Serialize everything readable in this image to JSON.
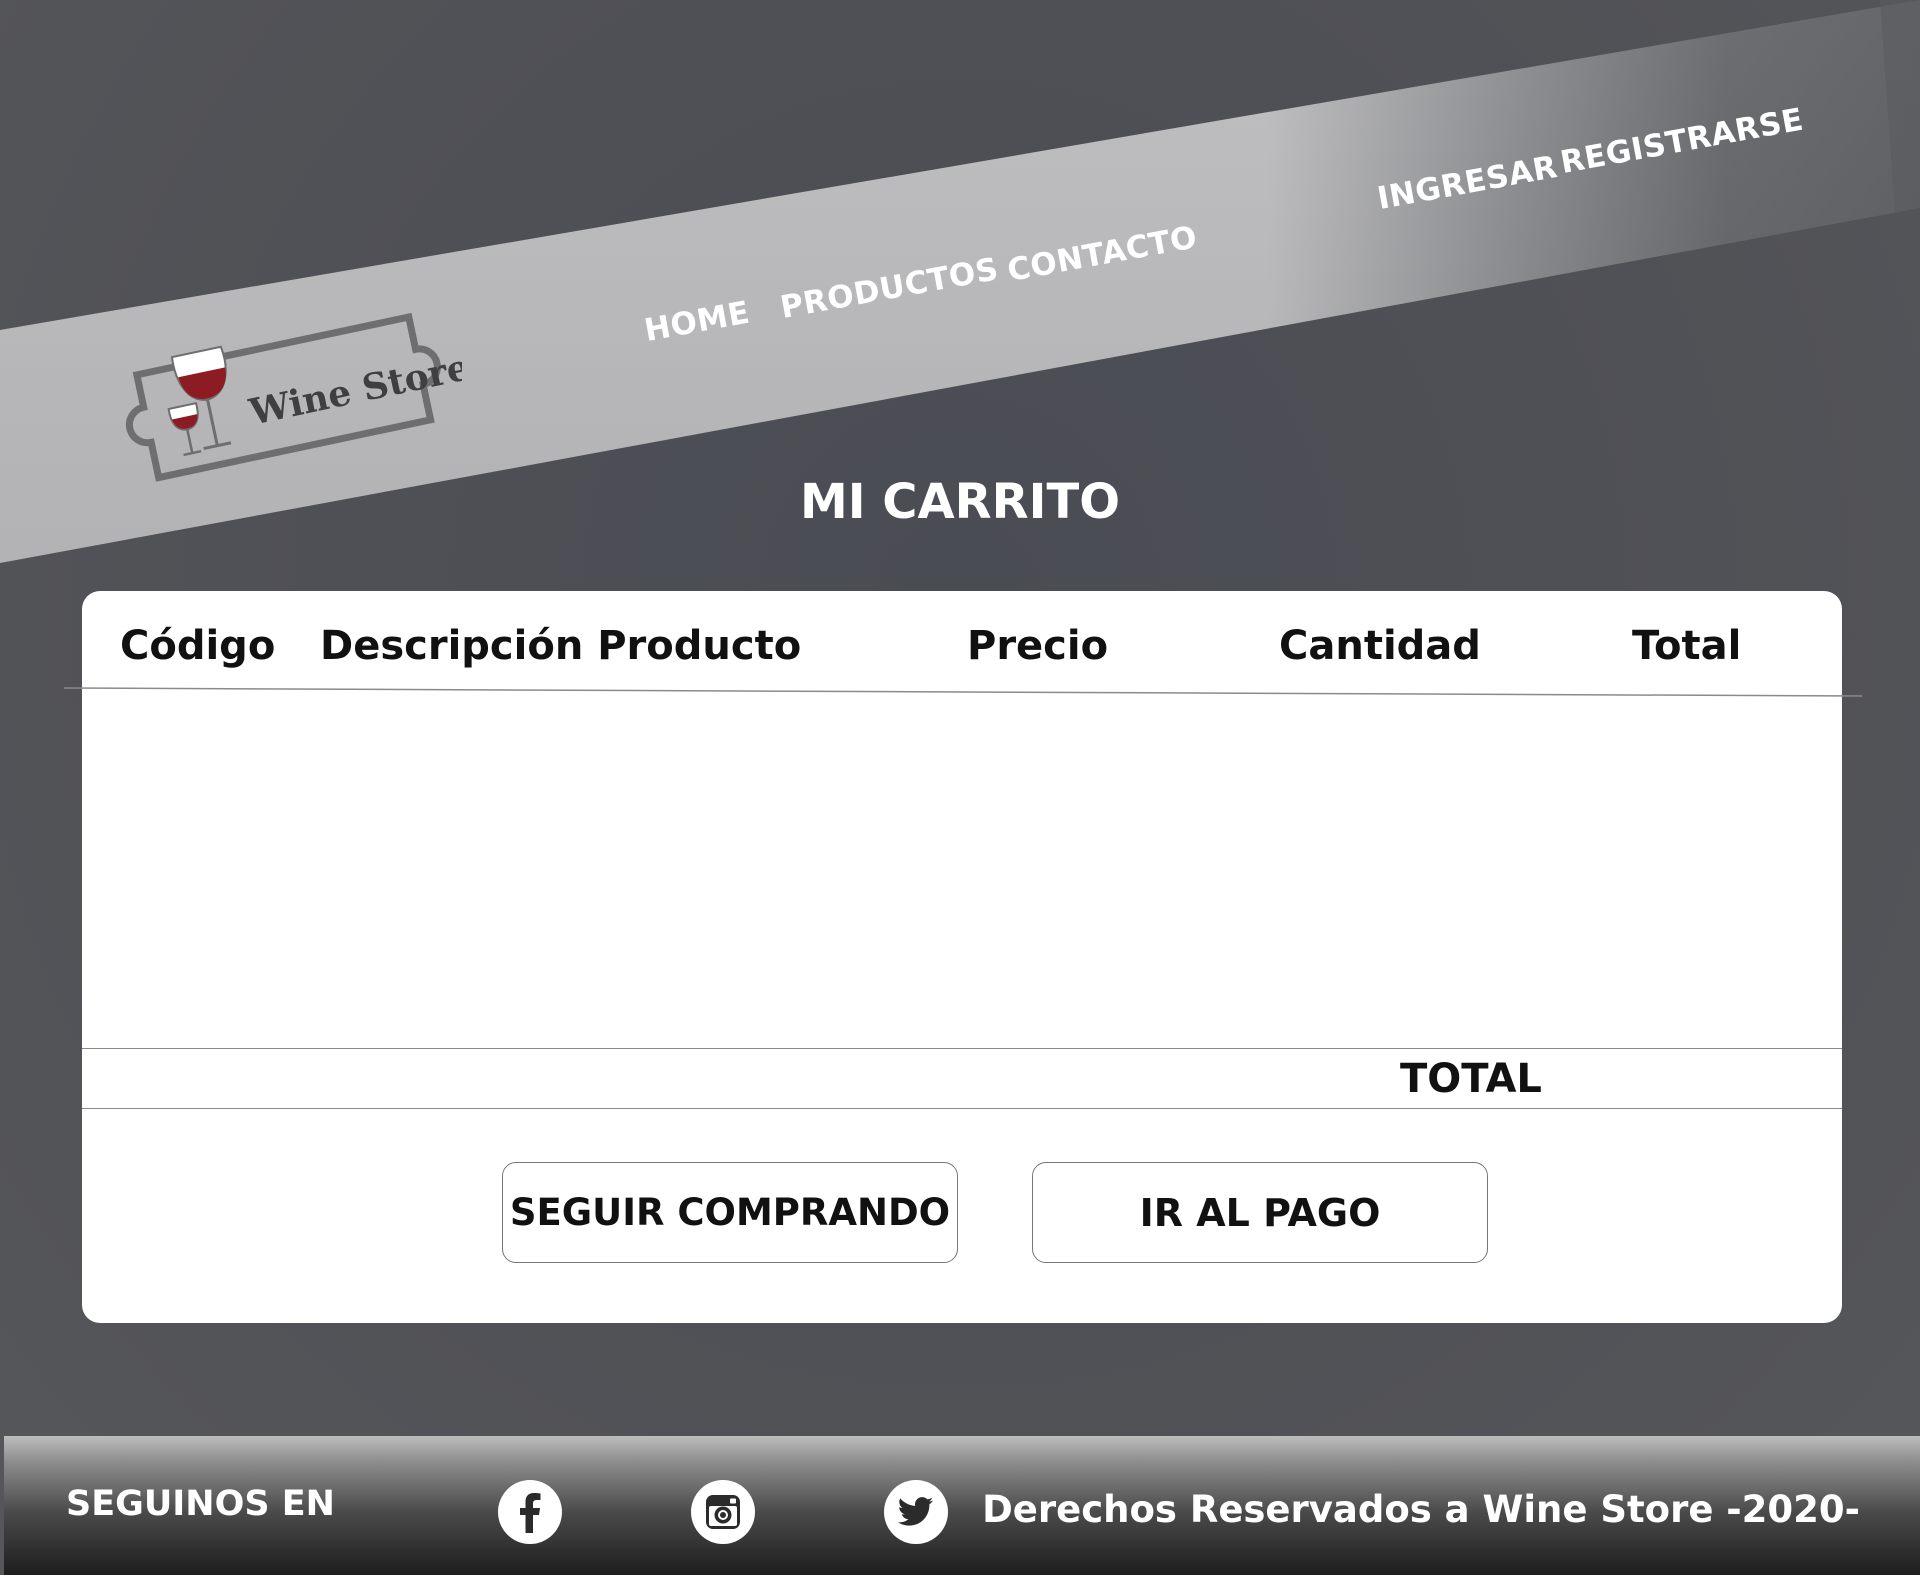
{
  "brand": {
    "logo_text": "Wine Store"
  },
  "nav": {
    "home": "HOME",
    "productos": "PRODUCTOS",
    "contacto": "CONTACTO",
    "ingresar": "INGRESAR",
    "registrarse": "REGISTRARSE"
  },
  "page": {
    "title": "MI CARRITO"
  },
  "cart": {
    "columns": {
      "codigo": "Código",
      "descripcion": "Descripción Producto",
      "precio": "Precio",
      "cantidad": "Cantidad",
      "total": "Total"
    },
    "rows": [],
    "total_label": "TOTAL",
    "buttons": {
      "seguir": "SEGUIR COMPRANDO",
      "pago": "IR AL PAGO"
    }
  },
  "footer": {
    "follow_label": "SEGUINOS EN",
    "socials": [
      "facebook-icon",
      "instagram-icon",
      "twitter-icon"
    ],
    "copyright": "Derechos Reservados a Wine Store -2020-"
  },
  "colors": {
    "background": "#505156",
    "band_light": "#bcbcbe",
    "band_dark": "#5e5f63",
    "wine_red": "#8c1b24",
    "card": "#ffffff",
    "text": "#111111",
    "footer_top": "#bdbdbd",
    "footer_bottom": "#1e1e1e"
  }
}
